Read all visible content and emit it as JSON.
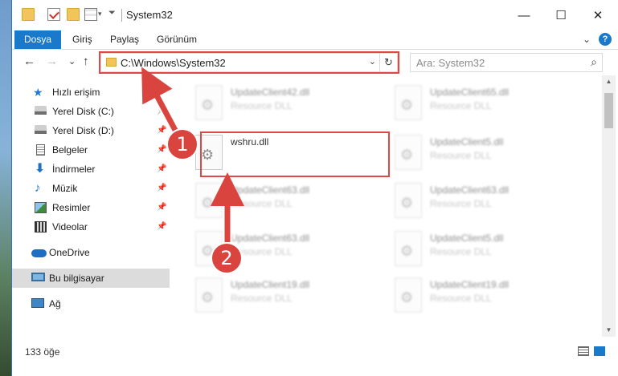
{
  "window": {
    "title": "System32",
    "controls": {
      "minimize": "—",
      "maximize": "☐",
      "close": "✕"
    }
  },
  "ribbon": {
    "tabs": [
      {
        "label": "Dosya",
        "active": true
      },
      {
        "label": "Giriş"
      },
      {
        "label": "Paylaş"
      },
      {
        "label": "Görünüm"
      }
    ],
    "expand_glyph": "⌄"
  },
  "nav": {
    "back": "←",
    "forward": "→",
    "recent": "⌄",
    "up": "↑",
    "address": "C:\\Windows\\System32",
    "dropdown": "⌄",
    "refresh": "↻",
    "search_placeholder": "Ara: System32",
    "search_icon": "⌕"
  },
  "sidebar": {
    "items": [
      {
        "label": "Hızlı erişim",
        "icon": "star-icon",
        "glyph": "★"
      },
      {
        "label": "Yerel Disk (C:)",
        "icon": "disk-icon",
        "pinned": true
      },
      {
        "label": "Yerel Disk (D:)",
        "icon": "disk-icon",
        "pinned": true
      },
      {
        "label": "Belgeler",
        "icon": "document-icon",
        "pinned": true
      },
      {
        "label": "İndirmeler",
        "icon": "download-icon",
        "glyph": "⬇",
        "pinned": true
      },
      {
        "label": "Müzik",
        "icon": "music-icon",
        "glyph": "♪",
        "pinned": true
      },
      {
        "label": "Resimler",
        "icon": "pictures-icon",
        "pinned": true
      },
      {
        "label": "Videolar",
        "icon": "video-icon",
        "pinned": true
      },
      {
        "label": "OneDrive",
        "icon": "cloud-icon"
      },
      {
        "label": "Bu bilgisayar",
        "icon": "computer-icon",
        "selected": true
      },
      {
        "label": "Ağ",
        "icon": "network-icon"
      }
    ],
    "pin_glyph": "📌"
  },
  "files": [
    {
      "name": "UpdateClient42.dll",
      "type": "Resource DLL"
    },
    {
      "name": "UpdateClient65.dll",
      "type": "Resource DLL"
    },
    {
      "name": "wshru.dll",
      "type": ""
    },
    {
      "name": "UpdateClient5.dll",
      "type": "Resource DLL"
    },
    {
      "name": "UpdateClient63.dll",
      "type": "Resource DLL"
    },
    {
      "name": "UpdateClient63.dll",
      "type": "Resource DLL"
    },
    {
      "name": "UpdateClient63.dll",
      "type": "Resource DLL"
    },
    {
      "name": "UpdateClient5.dll",
      "type": "Resource DLL"
    },
    {
      "name": "UpdateClient19.dll",
      "type": "Resource DLL"
    },
    {
      "name": "UpdateClient19.dll",
      "type": "Resource DLL"
    }
  ],
  "status": {
    "item_count": "133 öğe"
  },
  "annotations": {
    "step1": "1",
    "step2": "2",
    "color": "#d9453e"
  }
}
